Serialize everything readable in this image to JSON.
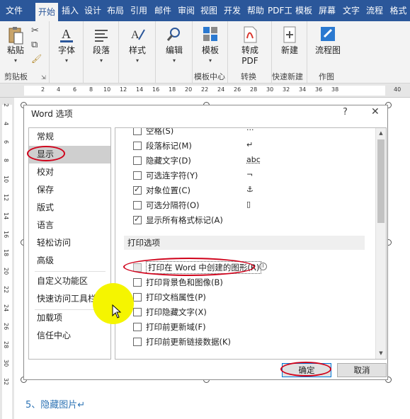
{
  "ribbon_tabs": [
    "文件",
    "开始",
    "插入",
    "设计",
    "布局",
    "引用",
    "邮件",
    "审阅",
    "视图",
    "开发",
    "帮助",
    "PDF工",
    "模板",
    "屏幕",
    "文字",
    "流程",
    "格式"
  ],
  "ribbon": {
    "clipboard": {
      "paste": "粘贴",
      "group": "剪贴板"
    },
    "font": "字体",
    "paragraph": "段落",
    "styles": "样式",
    "editing": "编辑",
    "template": {
      "label": "模板",
      "group": "模板中心"
    },
    "convert": {
      "label1": "转成",
      "label2": "PDF",
      "group": "转换"
    },
    "new": {
      "label": "新建",
      "group": "快速新建"
    },
    "flowchart": {
      "label": "流程图",
      "group": "作图"
    }
  },
  "ruler_numbers": [
    "2",
    "4",
    "6",
    "8",
    "10",
    "12",
    "14",
    "16",
    "18",
    "20",
    "22",
    "24",
    "26",
    "28",
    "30",
    "32",
    "34",
    "36",
    "38",
    "40"
  ],
  "vruler_numbers": [
    "2",
    "4",
    "6",
    "8",
    "10",
    "12",
    "14",
    "16",
    "18",
    "20",
    "22",
    "24",
    "26",
    "28",
    "30",
    "32"
  ],
  "dialog": {
    "title": "Word 选项",
    "help": "?",
    "close": "✕",
    "nav": [
      "常规",
      "显示",
      "校对",
      "保存",
      "版式",
      "语言",
      "轻松访问",
      "高级",
      "自定义功能区",
      "快速访问工具栏",
      "加载项",
      "信任中心"
    ],
    "display_options": [
      {
        "label": "空格(S)",
        "checked": false,
        "symbol": "···"
      },
      {
        "label": "段落标记(M)",
        "checked": false,
        "symbol": "↵"
      },
      {
        "label": "隐藏文字(D)",
        "checked": false,
        "symbol": "abc"
      },
      {
        "label": "可选连字符(Y)",
        "checked": false,
        "symbol": "¬"
      },
      {
        "label": "对象位置(C)",
        "checked": true,
        "symbol": "⚓"
      },
      {
        "label": "可选分隔符(O)",
        "checked": false,
        "symbol": "▯"
      },
      {
        "label": "显示所有格式标记(A)",
        "checked": true,
        "symbol": ""
      }
    ],
    "print_section": "打印选项",
    "print_options": [
      {
        "label": "打印在 Word 中创建的图形(R)",
        "checked": false,
        "disabled": true
      },
      {
        "label": "打印背景色和图像(B)",
        "checked": false
      },
      {
        "label": "打印文档属性(P)",
        "checked": false
      },
      {
        "label": "打印隐藏文字(X)",
        "checked": false
      },
      {
        "label": "打印前更新域(F)",
        "checked": false
      },
      {
        "label": "打印前更新链接数据(K)",
        "checked": false
      }
    ],
    "ok": "确定",
    "cancel": "取消"
  },
  "document_text": "5、隐藏图片↵",
  "colors": {
    "ribbon_blue": "#2b579a",
    "highlight": "#d0021b",
    "cursor_highlight": "#f5f500"
  }
}
